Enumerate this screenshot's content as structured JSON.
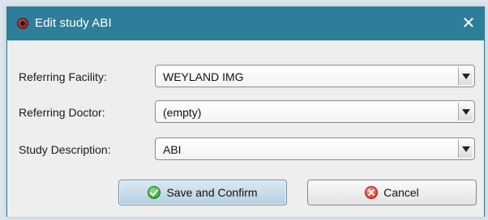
{
  "dialog": {
    "title": "Edit study ABI",
    "close_symbol": "✕"
  },
  "fields": [
    {
      "label": "Referring Facility:",
      "value": "WEYLAND IMG"
    },
    {
      "label": "Referring Doctor:",
      "value": "(empty)"
    },
    {
      "label": "Study Description:",
      "value": "ABI"
    }
  ],
  "buttons": {
    "save_label": "Save and Confirm",
    "cancel_label": "Cancel"
  },
  "icons": {
    "app": "app-logo-icon",
    "close": "close-icon",
    "save": "check-circle-icon",
    "cancel": "cancel-circle-icon",
    "dropdown": "chevron-down-icon"
  },
  "colors": {
    "titlebar": "#2f7e99",
    "window_background": "#eeeeee",
    "save_button": "#c8dcea",
    "cancel_button": "#eeeeee"
  }
}
